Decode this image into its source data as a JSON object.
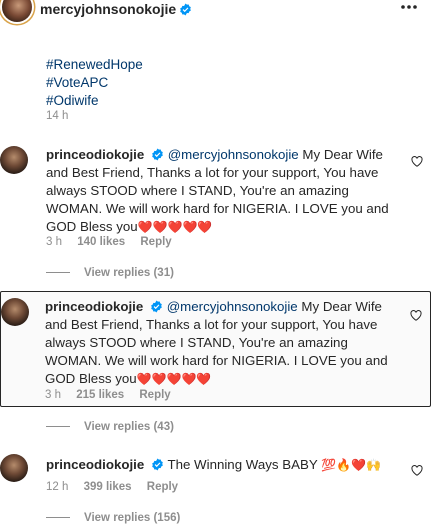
{
  "post": {
    "username": "mercyjohnsonokojie",
    "hashtags": [
      "#RenewedHope",
      "#VoteAPC",
      "#Odiwife"
    ],
    "time": "14 h"
  },
  "comments": [
    {
      "username": "princeodiokojie",
      "mention": "@mercyjohnsonokojie",
      "text": "My Dear Wife and Best Friend, Thanks a lot for your support, You have always STOOD where I STAND, You're an amazing WOMAN. We will work hard for NIGERIA. I LOVE you and GOD Bless you",
      "emojis": "❤️❤️❤️❤️❤️",
      "time": "3 h",
      "likes": "140 likes",
      "reply": "Reply",
      "view_replies": "View replies (31)"
    },
    {
      "username": "princeodiokojie",
      "mention": "@mercyjohnsonokojie",
      "text": "My Dear Wife and Best Friend, Thanks a lot for your support, You have always STOOD where I STAND, You're an amazing WOMAN. We will work hard for NIGERIA. I LOVE you and GOD Bless you",
      "emojis": "❤️❤️❤️❤️❤️",
      "time": "3 h",
      "likes": "215 likes",
      "reply": "Reply",
      "view_replies": "View replies (43)"
    },
    {
      "username": "princeodiokojie",
      "text": "The Winning Ways BABY",
      "emojis": "💯🔥❤️🙌",
      "time": "12 h",
      "likes": "399 likes",
      "reply": "Reply",
      "view_replies": "View replies (156)"
    }
  ],
  "colors": {
    "link": "#00376b",
    "muted": "#8e8e8e",
    "verified": "#0095f6",
    "text": "#262626"
  }
}
